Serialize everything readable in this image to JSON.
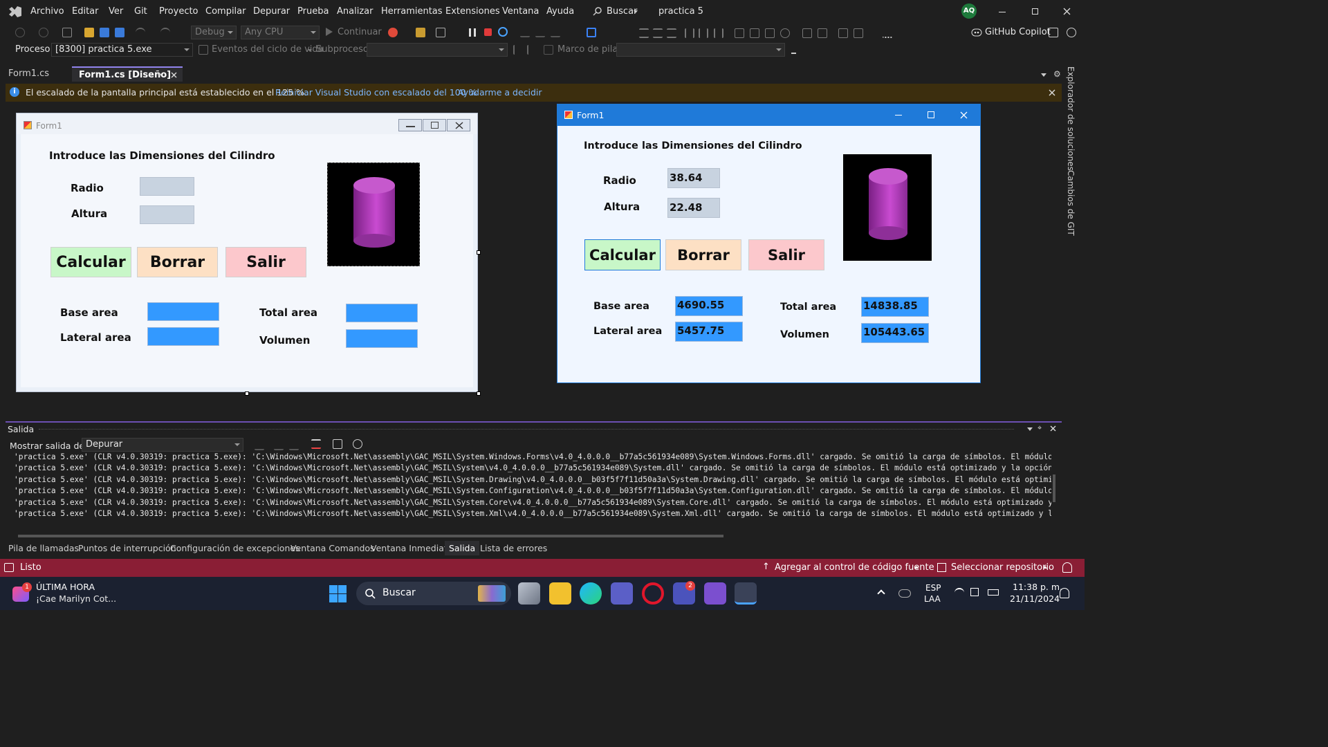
{
  "menu": {
    "items": [
      "Archivo",
      "Editar",
      "Ver",
      "Git",
      "Proyecto",
      "Compilar",
      "Depurar",
      "Prueba",
      "Analizar",
      "Herramientas",
      "Extensiones",
      "Ventana",
      "Ayuda"
    ],
    "search_label": "Buscar",
    "solution_name": "practica 5",
    "avatar_initials": "AQ"
  },
  "toolbar": {
    "config": "Debug",
    "platform": "Any CPU",
    "continue_label": "Continuar",
    "copilot_label": "GitHub Copilot"
  },
  "debugbar": {
    "process_label": "Proceso:",
    "process_value": "[8300] practica 5.exe",
    "lifecycle_label": "Eventos del ciclo de vida",
    "thread_label": "Subproceso:",
    "stackframe_label": "Marco de pila:"
  },
  "tabs": [
    {
      "label": "Form1.cs",
      "active": false
    },
    {
      "label": "Form1.cs [Diseño]",
      "active": true
    }
  ],
  "infobar": {
    "message": "El escalado de la pantalla principal está establecido en el 125 %.",
    "link1": "Reiniciar Visual Studio con escalado del 100 %",
    "link2": "Ayudarme a decidir"
  },
  "side_panels": [
    "Explorador de soluciones",
    "Cambios de GIT"
  ],
  "design_form": {
    "title": "Form1",
    "heading": "Introduce las Dimensiones del Cilindro",
    "radio_label": "Radio",
    "altura_label": "Altura",
    "btn_calcular": "Calcular",
    "btn_borrar": "Borrar",
    "btn_salir": "Salir",
    "base_area_label": "Base area",
    "lateral_area_label": "Lateral area",
    "total_area_label": "Total area",
    "volumen_label": "Volumen"
  },
  "runtime_form": {
    "title": "Form1",
    "heading": "Introduce las Dimensiones del Cilindro",
    "radio_label": "Radio",
    "radio_value": "38.64",
    "altura_label": "Altura",
    "altura_value": "22.48",
    "btn_calcular": "Calcular",
    "btn_borrar": "Borrar",
    "btn_salir": "Salir",
    "base_area_label": "Base area",
    "base_area_value": "4690.55",
    "lateral_area_label": "Lateral area",
    "lateral_area_value": "5457.75",
    "total_area_label": "Total area",
    "total_area_value": "14838.85",
    "volumen_label": "Volumen",
    "volumen_value": "105443.65"
  },
  "output": {
    "title": "Salida",
    "show_from_label": "Mostrar salida de:",
    "show_from_value": "Depurar",
    "lines": [
      "'practica 5.exe' (CLR v4.0.30319: practica 5.exe): 'C:\\Windows\\Microsoft.Net\\assembly\\GAC_MSIL\\System.Windows.Forms\\v4.0_4.0.0.0__b77a5c561934e089\\System.Windows.Forms.dll' cargado. Se omitió la carga de símbolos. El módulo está",
      "'practica 5.exe' (CLR v4.0.30319: practica 5.exe): 'C:\\Windows\\Microsoft.Net\\assembly\\GAC_MSIL\\System\\v4.0_4.0.0.0__b77a5c561934e089\\System.dll' cargado. Se omitió la carga de símbolos. El módulo está optimizado y la opción del d",
      "'practica 5.exe' (CLR v4.0.30319: practica 5.exe): 'C:\\Windows\\Microsoft.Net\\assembly\\GAC_MSIL\\System.Drawing\\v4.0_4.0.0.0__b03f5f7f11d50a3a\\System.Drawing.dll' cargado. Se omitió la carga de símbolos. El módulo está optimizado y",
      "'practica 5.exe' (CLR v4.0.30319: practica 5.exe): 'C:\\Windows\\Microsoft.Net\\assembly\\GAC_MSIL\\System.Configuration\\v4.0_4.0.0.0__b03f5f7f11d50a3a\\System.Configuration.dll' cargado. Se omitió la carga de símbolos. El módulo está",
      "'practica 5.exe' (CLR v4.0.30319: practica 5.exe): 'C:\\Windows\\Microsoft.Net\\assembly\\GAC_MSIL\\System.Core\\v4.0_4.0.0.0__b77a5c561934e089\\System.Core.dll' cargado. Se omitió la carga de símbolos. El módulo está optimizado y la op",
      "'practica 5.exe' (CLR v4.0.30319: practica 5.exe): 'C:\\Windows\\Microsoft.Net\\assembly\\GAC_MSIL\\System.Xml\\v4.0_4.0.0.0__b77a5c561934e089\\System.Xml.dll' cargado. Se omitió la carga de símbolos. El módulo está optimizado y la opci"
    ]
  },
  "bottom_tabs": [
    "Pila de llamadas",
    "Puntos de interrupción",
    "Configuración de excepciones",
    "Ventana Comandos",
    "Ventana Inmediato",
    "Salida",
    "Lista de errores"
  ],
  "status": {
    "ready": "Listo",
    "add_source_control": "Agregar al control de código fuente",
    "select_repo": "Seleccionar repositorio"
  },
  "taskbar": {
    "news_title": "ÚLTIMA HORA",
    "news_sub": "¡Cae Marilyn Cot...",
    "news_badge": "1",
    "search_label": "Buscar",
    "teams_badge": "2",
    "lang": "ESP",
    "lang_sub": "LAA",
    "time": "11:38 p. m.",
    "date": "21/11/2024"
  },
  "colors": {
    "vs_purple": "#6c4fb3",
    "status_red": "#8a1e35",
    "calcular_bg": "#c8f7c8",
    "borrar_bg": "#fde0c4",
    "salir_bg": "#fcc8cc",
    "result_blue": "#3399ff"
  }
}
